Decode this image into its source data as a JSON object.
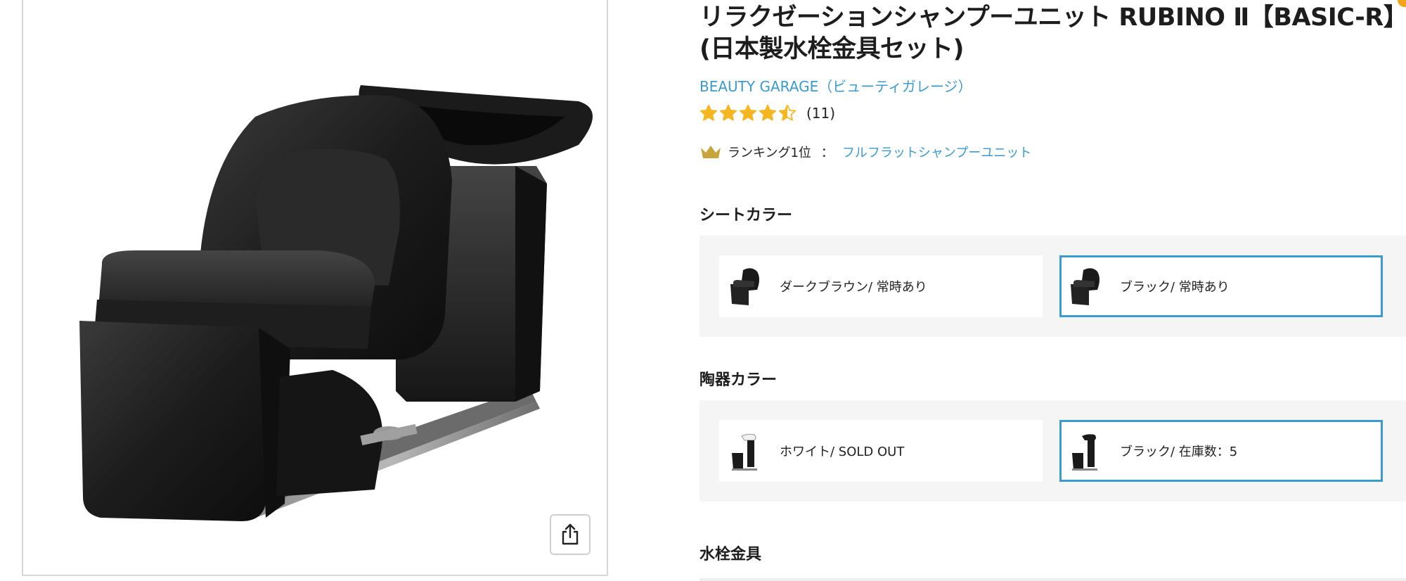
{
  "product": {
    "title": "リラクゼーションシャンプーユニット RUBINO Ⅱ【BASIC-R】(日本製水栓金具セット)",
    "brand": "BEAUTY GARAGE（ビューティガレージ）",
    "rating": 4.5,
    "review_count": "(11)"
  },
  "ranking": {
    "label": "ランキング1位",
    "separator": "：",
    "category_link": "フルフラットシャンプーユニット"
  },
  "seat_color": {
    "title": "シートカラー",
    "options": [
      {
        "label": "ダークブラウン/ 常時あり",
        "selected": false
      },
      {
        "label": "ブラック/ 常時あり",
        "selected": true
      }
    ]
  },
  "bowl_color": {
    "title": "陶器カラー",
    "options": [
      {
        "label": "ホワイト/ SOLD OUT",
        "selected": false
      },
      {
        "label": "ブラック/ 在庫数：5",
        "selected": true
      }
    ]
  },
  "faucet": {
    "title": "水栓金具"
  },
  "icons": {
    "share": "share-icon",
    "crown": "crown-icon",
    "star": "star-icon"
  },
  "colors": {
    "link": "#3a9bd0",
    "star": "#f4b71f",
    "crown": "#c8a53a",
    "selected_border": "#3a9bd0",
    "group_bg": "#f5f5f5"
  }
}
